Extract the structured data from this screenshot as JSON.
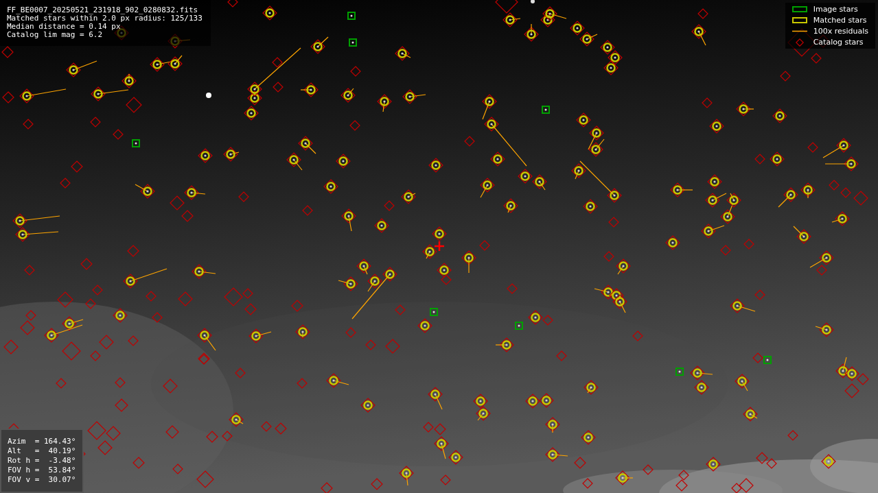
{
  "info_lines": [
    "FF_BE0007_20250521_231918_902_0280832.fits",
    "Matched stars within 2.0 px radius: 125/133",
    "Median distance = 0.14 px",
    "Catalog lim mag = 6.2"
  ],
  "legend": [
    {
      "label": "Image stars",
      "kind": "box",
      "color": "#00a000"
    },
    {
      "label": "Matched stars",
      "kind": "box",
      "color": "#c8c800"
    },
    {
      "label": "100x residuals",
      "kind": "line",
      "color": "#ffa500"
    },
    {
      "label": "Catalog stars",
      "kind": "diamond",
      "color": "#c00000"
    }
  ],
  "pointing": [
    "Azim  = 164.43°",
    "Alt   =  40.19°",
    "Rot h =  -3.48°",
    "FOV h =  53.84°",
    "FOV v =  30.07°"
  ]
}
